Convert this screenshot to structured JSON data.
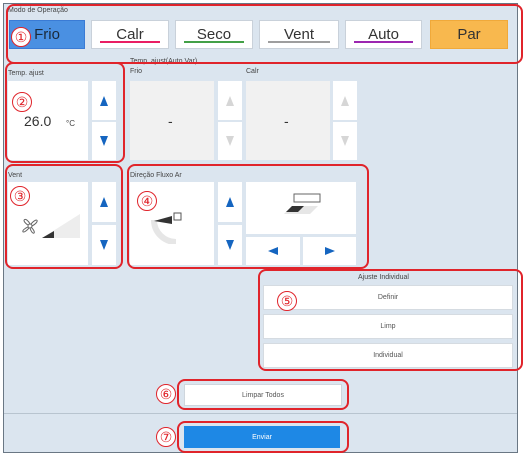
{
  "colors": {
    "frio_active": "#4a90e2",
    "par_active": "#f8b84e",
    "arrow": "#1565c0",
    "callout": "#e0242b",
    "send": "#1e88e5"
  },
  "mode": {
    "title": "Modo de Operação",
    "buttons": [
      {
        "label": "Frio",
        "line": "#3a7bd5"
      },
      {
        "label": "Calr",
        "line": "#e91e63"
      },
      {
        "label": "Seco",
        "line": "#43a047"
      },
      {
        "label": "Vent",
        "line": "#9e9e9e"
      },
      {
        "label": "Auto",
        "line": "#9c27b0"
      },
      {
        "label": "Par",
        "line": ""
      }
    ]
  },
  "temp": {
    "title": "Temp. ajust",
    "value": "26.0",
    "unit": "°C"
  },
  "auto_temp": {
    "title": "Temp. ajust(Auto Var)",
    "frio_label": "Frio",
    "calr_label": "Calr",
    "frio_value": "-",
    "calr_value": "-"
  },
  "vent": {
    "title": "Vent"
  },
  "airflow": {
    "title": "Direção Fluxo Ar"
  },
  "individual": {
    "title": "Ajuste Individual",
    "buttons": [
      "Definir",
      "Limp",
      "Individual"
    ]
  },
  "clear_all": "Limpar Todos",
  "send": "Enviar",
  "callouts": [
    "①",
    "②",
    "③",
    "④",
    "⑤",
    "⑥",
    "⑦"
  ]
}
